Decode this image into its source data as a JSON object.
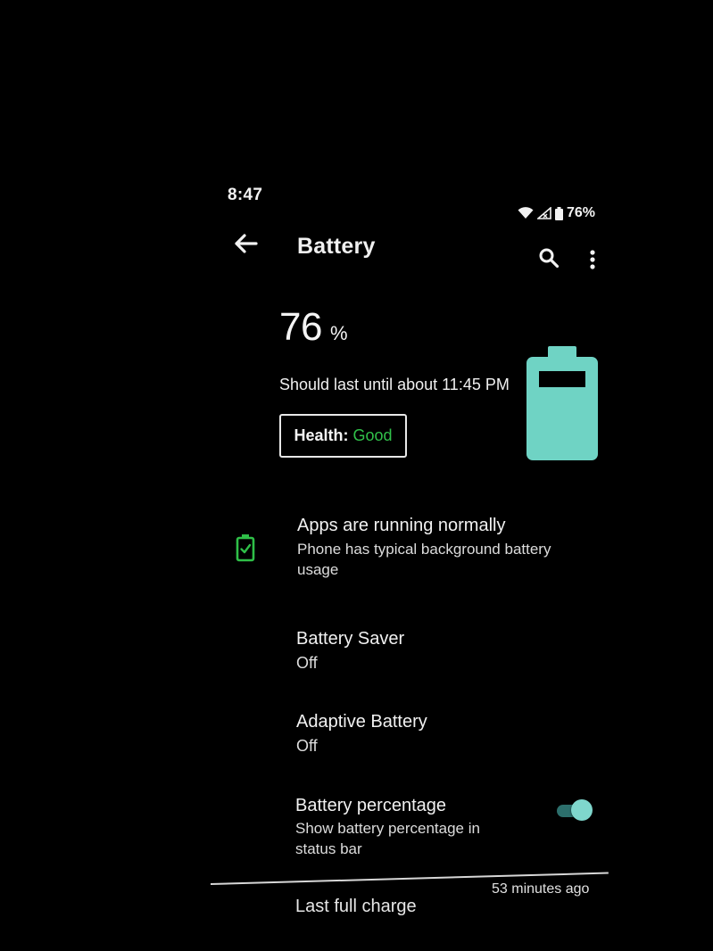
{
  "status_bar": {
    "time": "8:47",
    "battery_text": "76%",
    "icons": [
      "wifi-icon",
      "signal-icon",
      "battery-status-icon"
    ]
  },
  "app_bar": {
    "title": "Battery",
    "back_icon": "arrow-back-icon",
    "search_icon": "search-icon",
    "more_icon": "more-vert-icon"
  },
  "battery": {
    "percent": "76",
    "percent_unit": "%",
    "level": 0.76,
    "estimate": "Should last until about 11:45 PM",
    "health_label": "Health:",
    "health_value": "Good",
    "graphic_color": "#6fd3c4"
  },
  "tip": {
    "icon": "battery-ok-icon",
    "icon_color": "#2fbf48",
    "title": "Apps are running normally",
    "subtitle": "Phone has typical background battery usage"
  },
  "battery_saver": {
    "title": "Battery Saver",
    "summary": "Off"
  },
  "adaptive_battery": {
    "title": "Adaptive Battery",
    "summary": "Off"
  },
  "battery_percentage": {
    "title": "Battery percentage",
    "summary": "Show battery percentage in status bar",
    "enabled": true
  },
  "last_full_charge": {
    "label": "Last full charge",
    "value": "53 minutes ago"
  },
  "colors": {
    "background": "#000000",
    "accent": "#7fd6cc",
    "good": "#31c14a"
  }
}
